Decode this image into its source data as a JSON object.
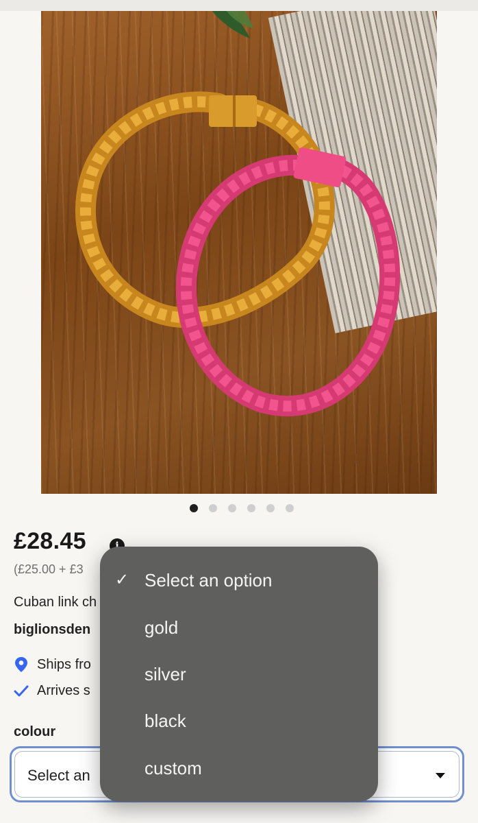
{
  "gallery": {
    "dots": 6,
    "active_dot": 1
  },
  "product": {
    "price": "£28.45",
    "info_icon": "i",
    "subprice": "(£25.00 + £3",
    "title": "Cuban link ch",
    "seller": "biglionsden",
    "shipping": "Ships fro",
    "arrival": "Arrives s"
  },
  "variation": {
    "label": "colour",
    "select_value": "Select an"
  },
  "dropdown": {
    "options": [
      {
        "label": "Select an option",
        "selected": true
      },
      {
        "label": "gold",
        "selected": false
      },
      {
        "label": "silver",
        "selected": false
      },
      {
        "label": "black",
        "selected": false
      },
      {
        "label": "custom",
        "selected": false
      }
    ],
    "check_glyph": "✓"
  },
  "colors": {
    "accent": "#3665f3",
    "menu_bg": "#5f5f5d",
    "focus_border": "#6f8fd0"
  }
}
